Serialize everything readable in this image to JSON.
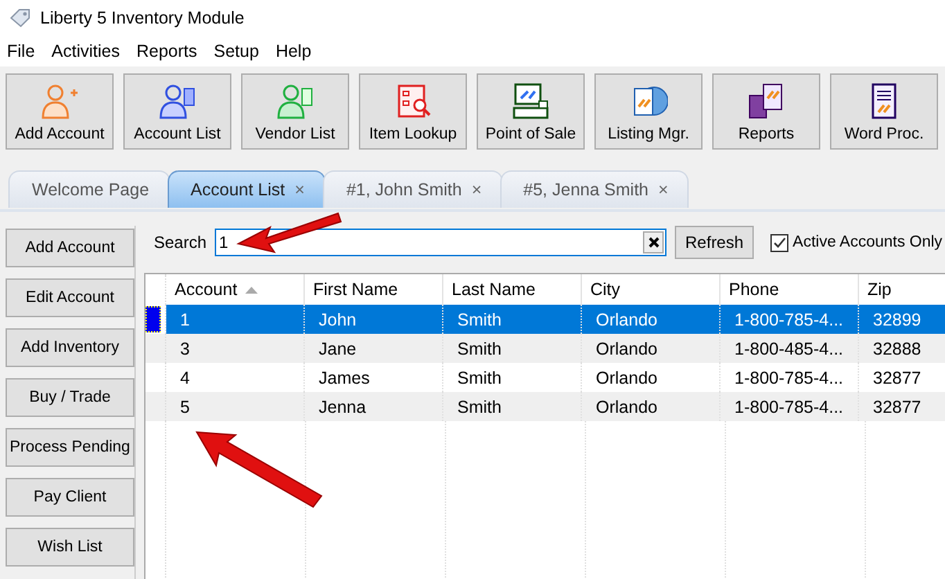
{
  "window": {
    "title": "Liberty 5 Inventory Module"
  },
  "menu": [
    "File",
    "Activities",
    "Reports",
    "Setup",
    "Help"
  ],
  "toolbar": [
    {
      "label": "Add Account"
    },
    {
      "label": "Account List"
    },
    {
      "label": "Vendor List"
    },
    {
      "label": "Item Lookup"
    },
    {
      "label": "Point of Sale"
    },
    {
      "label": "Listing Mgr."
    },
    {
      "label": "Reports"
    },
    {
      "label": "Word Proc."
    }
  ],
  "tabs": [
    {
      "label": "Welcome Page",
      "selected": false
    },
    {
      "label": "Account List",
      "selected": true,
      "close": "×"
    },
    {
      "label": "#1, John Smith",
      "selected": false,
      "close": "×"
    },
    {
      "label": "#5, Jenna Smith",
      "selected": false,
      "close": "×"
    }
  ],
  "sidebar": [
    "Add Account",
    "Edit Account",
    "Add Inventory",
    "Buy / Trade",
    "Process Pending",
    "Pay Client",
    "Wish List"
  ],
  "search": {
    "label": "Search",
    "value": "1",
    "refresh": "Refresh",
    "active_only": {
      "label": "Active Accounts Only",
      "checked": true
    }
  },
  "table": {
    "columns": [
      "Account",
      "First Name",
      "Last Name",
      "City",
      "Phone",
      "Zip"
    ],
    "rows": [
      {
        "cells": [
          "1",
          "John",
          "Smith",
          "Orlando",
          "1-800-785-4...",
          "32899"
        ],
        "selected": true
      },
      {
        "cells": [
          "3",
          "Jane",
          "Smith",
          "Orlando",
          "1-800-485-4...",
          "32888"
        ],
        "selected": false
      },
      {
        "cells": [
          "4",
          "James",
          "Smith",
          "Orlando",
          "1-800-785-4...",
          "32877"
        ],
        "selected": false
      },
      {
        "cells": [
          "5",
          "Jenna",
          "Smith",
          "Orlando",
          "1-800-785-4...",
          "32877"
        ],
        "selected": false
      }
    ]
  }
}
